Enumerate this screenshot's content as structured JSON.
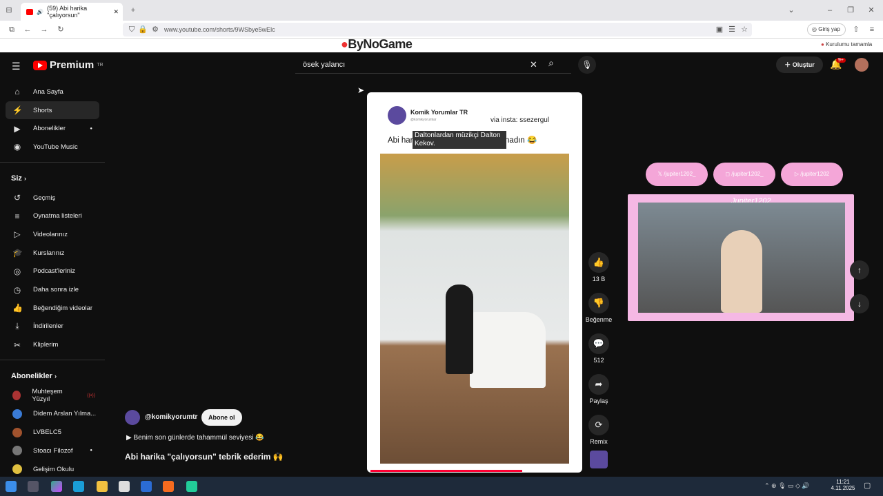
{
  "browser": {
    "tab_title": "(59) Abi harika \"çalıyorsun\"",
    "url": "www.youtube.com/shorts/9WSbye5wElc",
    "login_label": "Giriş yap",
    "bookmark_label": "Kurulumu tamamla",
    "watermark": "ByNoGame"
  },
  "youtube": {
    "logo_text": "Premium",
    "logo_region": "TR",
    "search_value": "ösek yalancı",
    "create_label": "Oluştur",
    "notif_count": "9+",
    "sidebar": {
      "main": [
        {
          "label": "Ana Sayfa",
          "icon": "home-icon"
        },
        {
          "label": "Shorts",
          "icon": "shorts-icon"
        },
        {
          "label": "Abonelikler",
          "icon": "subscriptions-icon"
        },
        {
          "label": "YouTube Music",
          "icon": "music-icon"
        }
      ],
      "you_header": "Siz",
      "you": [
        {
          "label": "Geçmiş"
        },
        {
          "label": "Oynatma listeleri"
        },
        {
          "label": "Videolarınız"
        },
        {
          "label": "Kurslarınız"
        },
        {
          "label": "Podcast'leriniz"
        },
        {
          "label": "Daha sonra izle"
        },
        {
          "label": "Beğendiğim videolar"
        },
        {
          "label": "İndirilenler"
        },
        {
          "label": "Kliplerim"
        }
      ],
      "subs_header": "Abonelikler",
      "subs": [
        {
          "label": "Muhteşem Yüzyıl",
          "color": "#a33"
        },
        {
          "label": "Didem Arslan Yılma...",
          "color": "#3a7bd5"
        },
        {
          "label": "LVBELC5",
          "color": "#a0522d"
        },
        {
          "label": "Stoacı Filozof",
          "color": "#777"
        },
        {
          "label": "Gelişim Okulu",
          "color": "#e0c040"
        }
      ]
    },
    "short": {
      "channel_name": "Komik Yorumlar TR",
      "channel_handle": "@komikyorumlar",
      "via": "via insta: ssezergul",
      "caption": "Abi harika mekânın ayarlarıyla oynadın 😂",
      "overlay": "Daltonlardan müzikçi Dalton Kekov.",
      "uploader": "@komikyorumtr",
      "subscribe": "Abone ol",
      "desc_line": "▶ Benim son günlerde tahammül seviyesi 😂",
      "title": "Abi harika \"çalıyorsun\" tebrik ederim 🙌"
    },
    "actions": {
      "likes": "13 B",
      "dislike": "Beğenme",
      "comments": "512",
      "share": "Paylaş",
      "remix": "Remix"
    },
    "stream": {
      "name": "Jupiter1202_",
      "social": [
        "/jupiter1202_",
        "/jupiter1202_",
        "/jupiter1202"
      ]
    }
  },
  "taskbar": {
    "time": "11:21",
    "date": "4.11.2025"
  }
}
